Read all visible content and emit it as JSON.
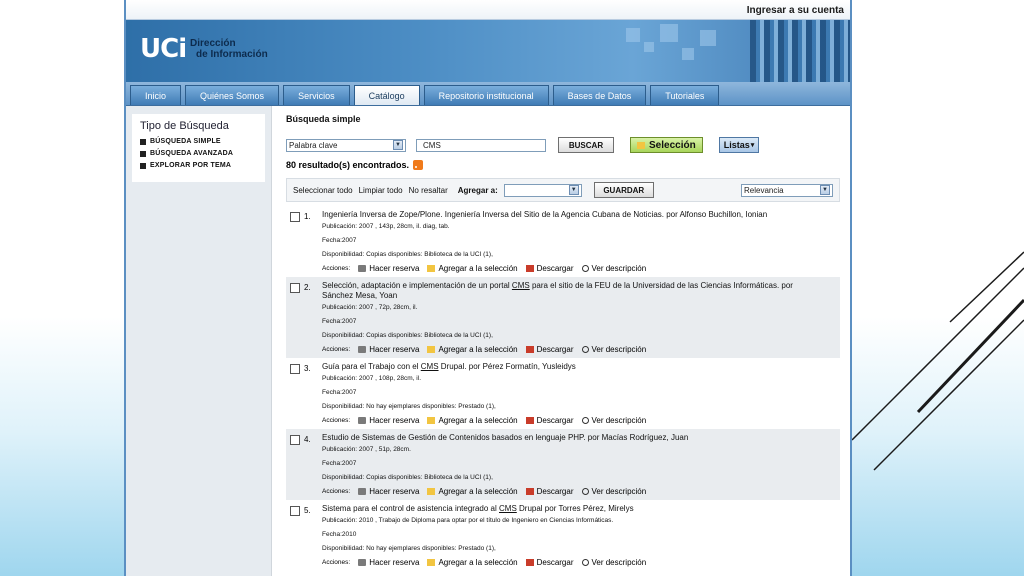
{
  "topbar": {
    "login_link": "Ingresar a su cuenta"
  },
  "banner": {
    "logo": "UCi",
    "logo_sub_1": "Dirección",
    "logo_sub_2": "de Información"
  },
  "nav": {
    "tabs": [
      {
        "label": "Inicio"
      },
      {
        "label": "Quiénes Somos"
      },
      {
        "label": "Servicios"
      },
      {
        "label": "Catálogo",
        "active": true
      },
      {
        "label": "Repositorio institucional"
      },
      {
        "label": "Bases de Datos"
      },
      {
        "label": "Tutoriales"
      }
    ]
  },
  "sidebar": {
    "title": "Tipo de Búsqueda",
    "items": [
      "BÚSQUEDA SIMPLE",
      "BÚSQUEDA AVANZADA",
      "EXPLORAR POR TEMA"
    ]
  },
  "search": {
    "heading": "Búsqueda simple",
    "field_select": "Palabra clave",
    "query": "CMS",
    "search_button": "BUSCAR",
    "selection_button": "Selección",
    "lists_button": "Listas",
    "result_count": "80 resultado(s) encontrados."
  },
  "toolbar": {
    "select_all": "Seleccionar todo",
    "clear_all": "Limpiar todo",
    "no_highlight": "No resaltar",
    "add_to_label": "Agregar a:",
    "add_to_value": "",
    "save_button": "GUARDAR",
    "sort_value": "Relevancia"
  },
  "actions_labels": {
    "acciones": "Acciones:",
    "reserve": "Hacer reserva",
    "add": "Agregar a la selección",
    "download": "Descargar",
    "view": "Ver descripción"
  },
  "results": [
    {
      "num": "1.",
      "title_pre": "Ingeniería Inversa de Zope/Plone. Ingeniería Inversa del Sitio de la Agencia Cubana de Noticias. por Alfonso Buchillon, Ionian",
      "title_cms": "",
      "title_post": "",
      "publication": "Publicación: 2007 , 143p, 28cm, il. diag, tab.",
      "date": "Fecha:2007",
      "availability": "Disponibilidad: Copias disponibles: Biblioteca de la UCI (1),"
    },
    {
      "num": "2.",
      "title_pre": "Selección, adaptación e implementación de un portal",
      "title_cms": "CMS",
      "title_post": "para el sitio de la FEU de la Universidad de las Ciencias Informáticas. por Sánchez Mesa, Yoan",
      "publication": "Publicación: 2007 , 72p, 28cm, il.",
      "date": "Fecha:2007",
      "availability": "Disponibilidad: Copias disponibles: Biblioteca de la UCI (1),"
    },
    {
      "num": "3.",
      "title_pre": "Guía para el Trabajo con el",
      "title_cms": "CMS",
      "title_post": "Drupal. por Pérez Formatín, Yusleidys",
      "publication": "Publicación: 2007 , 108p, 28cm, il.",
      "date": "Fecha:2007",
      "availability": "Disponibilidad: No hay ejemplares disponibles: Prestado (1),"
    },
    {
      "num": "4.",
      "title_pre": "Estudio de Sistemas de Gestión de Contenidos basados en lenguaje PHP. por Macías Rodríguez, Juan",
      "title_cms": "",
      "title_post": "",
      "publication": "Publicación: 2007 , 51p, 28cm.",
      "date": "Fecha:2007",
      "availability": "Disponibilidad: Copias disponibles: Biblioteca de la UCI (1),"
    },
    {
      "num": "5.",
      "title_pre": "Sistema para el control de asistencia integrado al",
      "title_cms": "CMS",
      "title_post": "Drupal por Torres Pérez, Mirelys",
      "publication": "Publicación: 2010 , Trabajo de Diploma para optar por el título de Ingeniero en Ciencias Informáticas.",
      "date": "Fecha:2010",
      "availability": "Disponibilidad: No hay ejemplares disponibles: Prestado (1),"
    }
  ]
}
